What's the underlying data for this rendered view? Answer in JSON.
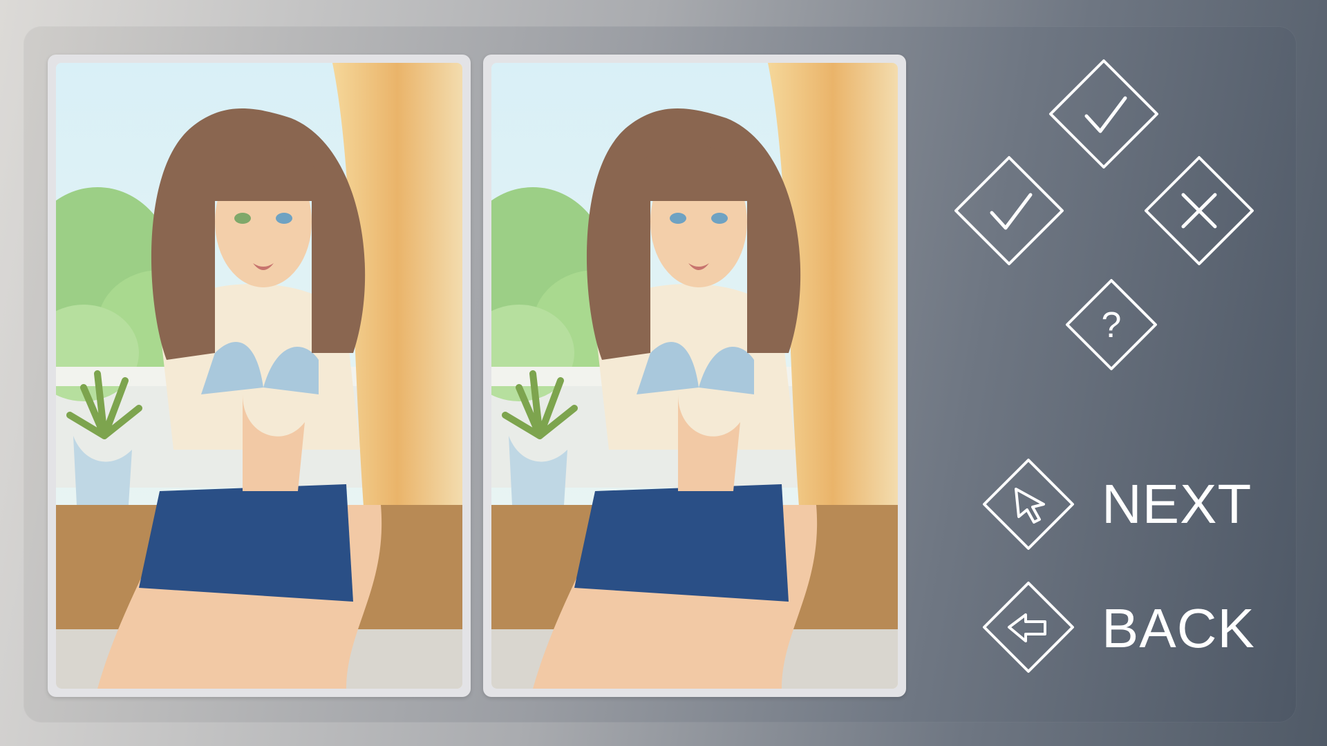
{
  "game": {
    "mode": "spot-the-difference",
    "images": [
      {
        "id": "original",
        "label": ""
      },
      {
        "id": "modified",
        "label": ""
      }
    ]
  },
  "controls": {
    "check_top": "check-icon",
    "check_left": "check-icon",
    "cross_right": "cross-icon",
    "hint": "question-icon",
    "hint_text": "?"
  },
  "nav": {
    "next_label": "NEXT",
    "back_label": "BACK"
  },
  "colors": {
    "icon_stroke": "#ffffff",
    "card_frame": "#e3e3e6",
    "label_color": "#ffffff"
  }
}
